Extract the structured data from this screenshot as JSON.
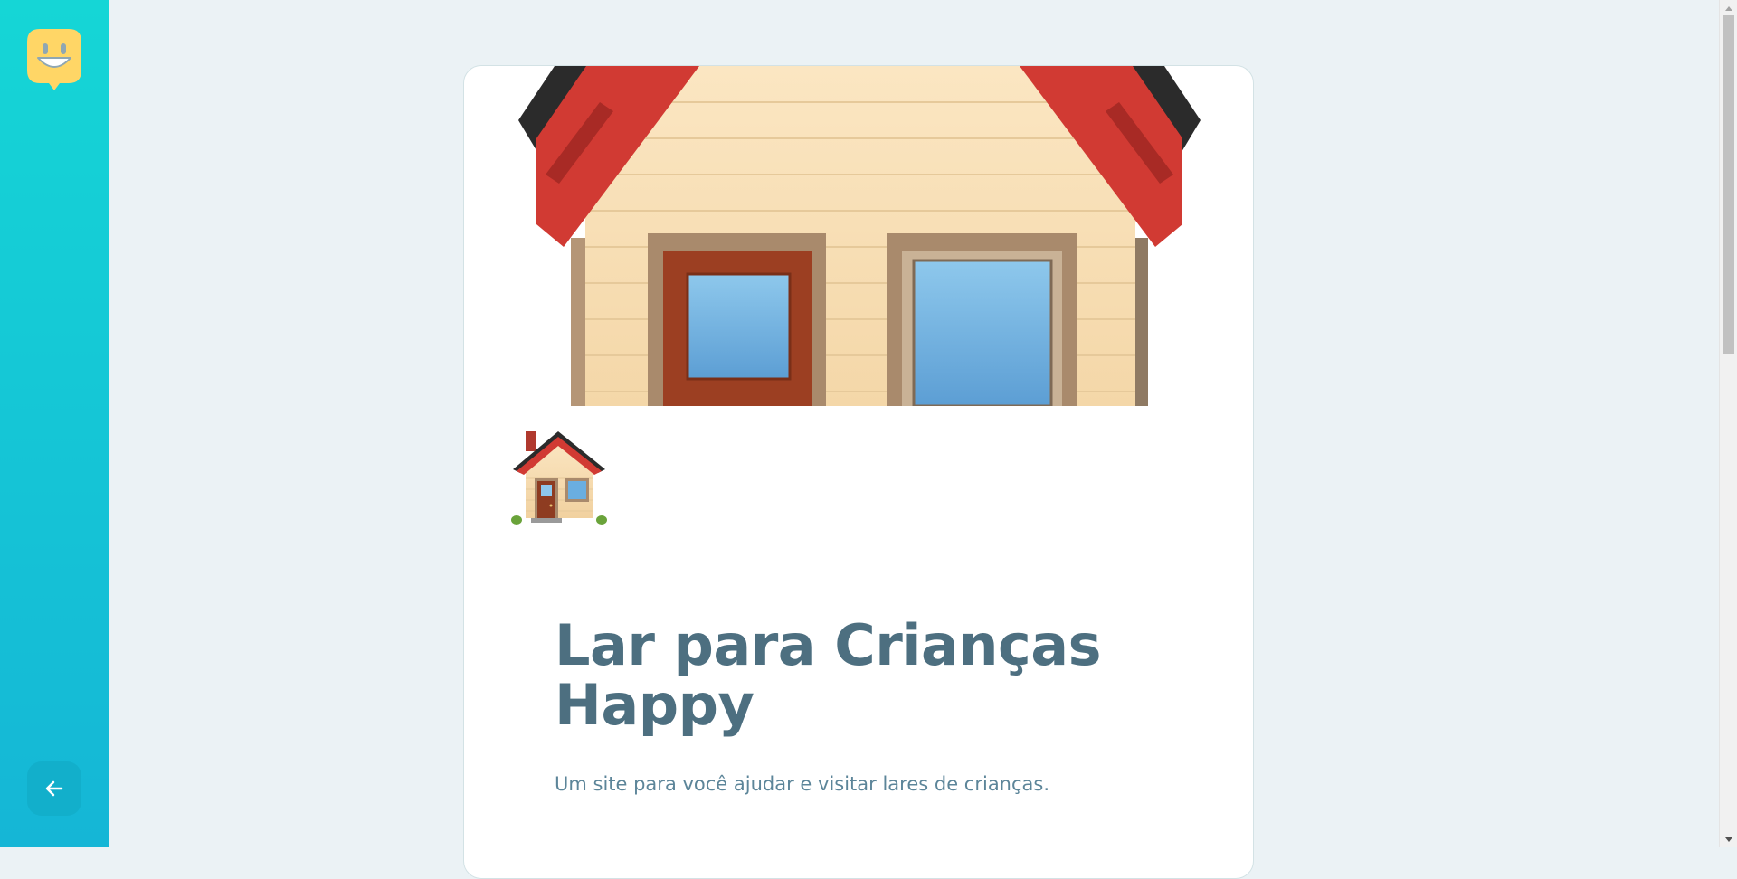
{
  "sidebar": {
    "logo_icon": "smiley-speech-bubble-icon",
    "back_icon": "arrow-left-icon"
  },
  "orphanage": {
    "cover_image": "house-emoji-image",
    "thumbnail_image": "house-emoji-image",
    "name": "Lar para Crianças Happy",
    "description": "Um site para você ajudar e visitar lares de crianças."
  },
  "colors": {
    "sidebar_gradient_start": "#15d6d6",
    "sidebar_gradient_end": "#15b6d6",
    "logo_yellow": "#ffd666",
    "title_color": "#4d6f80",
    "text_color": "#5c8599",
    "page_background": "#ebf2f5"
  }
}
